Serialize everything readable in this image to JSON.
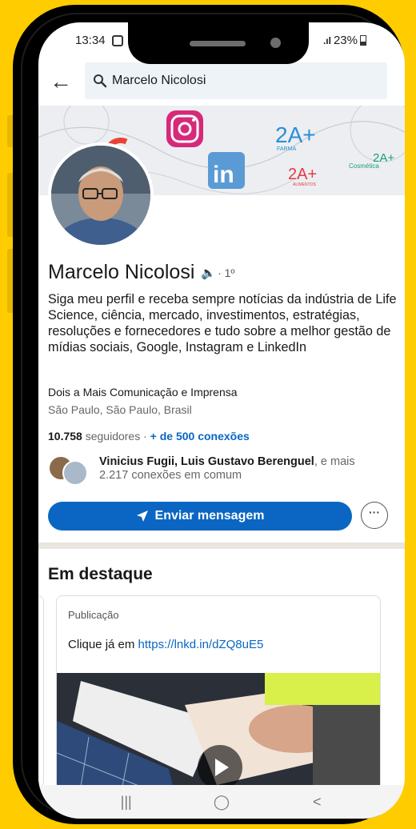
{
  "status_bar": {
    "time": "13:34",
    "signal": ".ıl",
    "battery": "23%"
  },
  "search": {
    "query": "Marcelo Nicolosi"
  },
  "cover": {
    "brand_2a_plus": "2A+",
    "brand_farma": "FARMA",
    "brand_2a_cosmetic": "2A+",
    "brand_cosmetic_sub": "Cosmética",
    "brand_2a_alimentos": "2A+",
    "brand_alimentos_sub": "ALIMENTOS"
  },
  "profile": {
    "name": "Marcelo Nicolosi",
    "degree": "· 1º",
    "headline": "Siga meu perfil e receba sempre notícias da indústria de Life Science, ciência, mercado, investimentos, estratégias, resoluções e fornecedores e tudo sobre a melhor gestão de mídias sociais, Google, Instagram e LinkedIn",
    "company": "Dois a Mais Comunicação e Imprensa",
    "location": "São Paulo, São Paulo, Brasil",
    "followers_count": "10.758",
    "followers_label": "seguidores ·",
    "connections": "+ de 500 conexões"
  },
  "mutual": {
    "names": "Vinicius Fugii, Luis Gustavo Berenguel",
    "suffix": ", e mais",
    "count_text": "2.217 conexões em comum"
  },
  "actions": {
    "message_label": "Enviar mensagem",
    "more_label": "···"
  },
  "featured": {
    "title": "Em destaque",
    "card_kind": "Publicação",
    "caption_text": "Clique já em",
    "caption_link": "https://lnkd.in/dZQ8uE5"
  },
  "colors": {
    "brand_blue": "#0A66C2",
    "frame_yellow": "#FFCC00"
  }
}
